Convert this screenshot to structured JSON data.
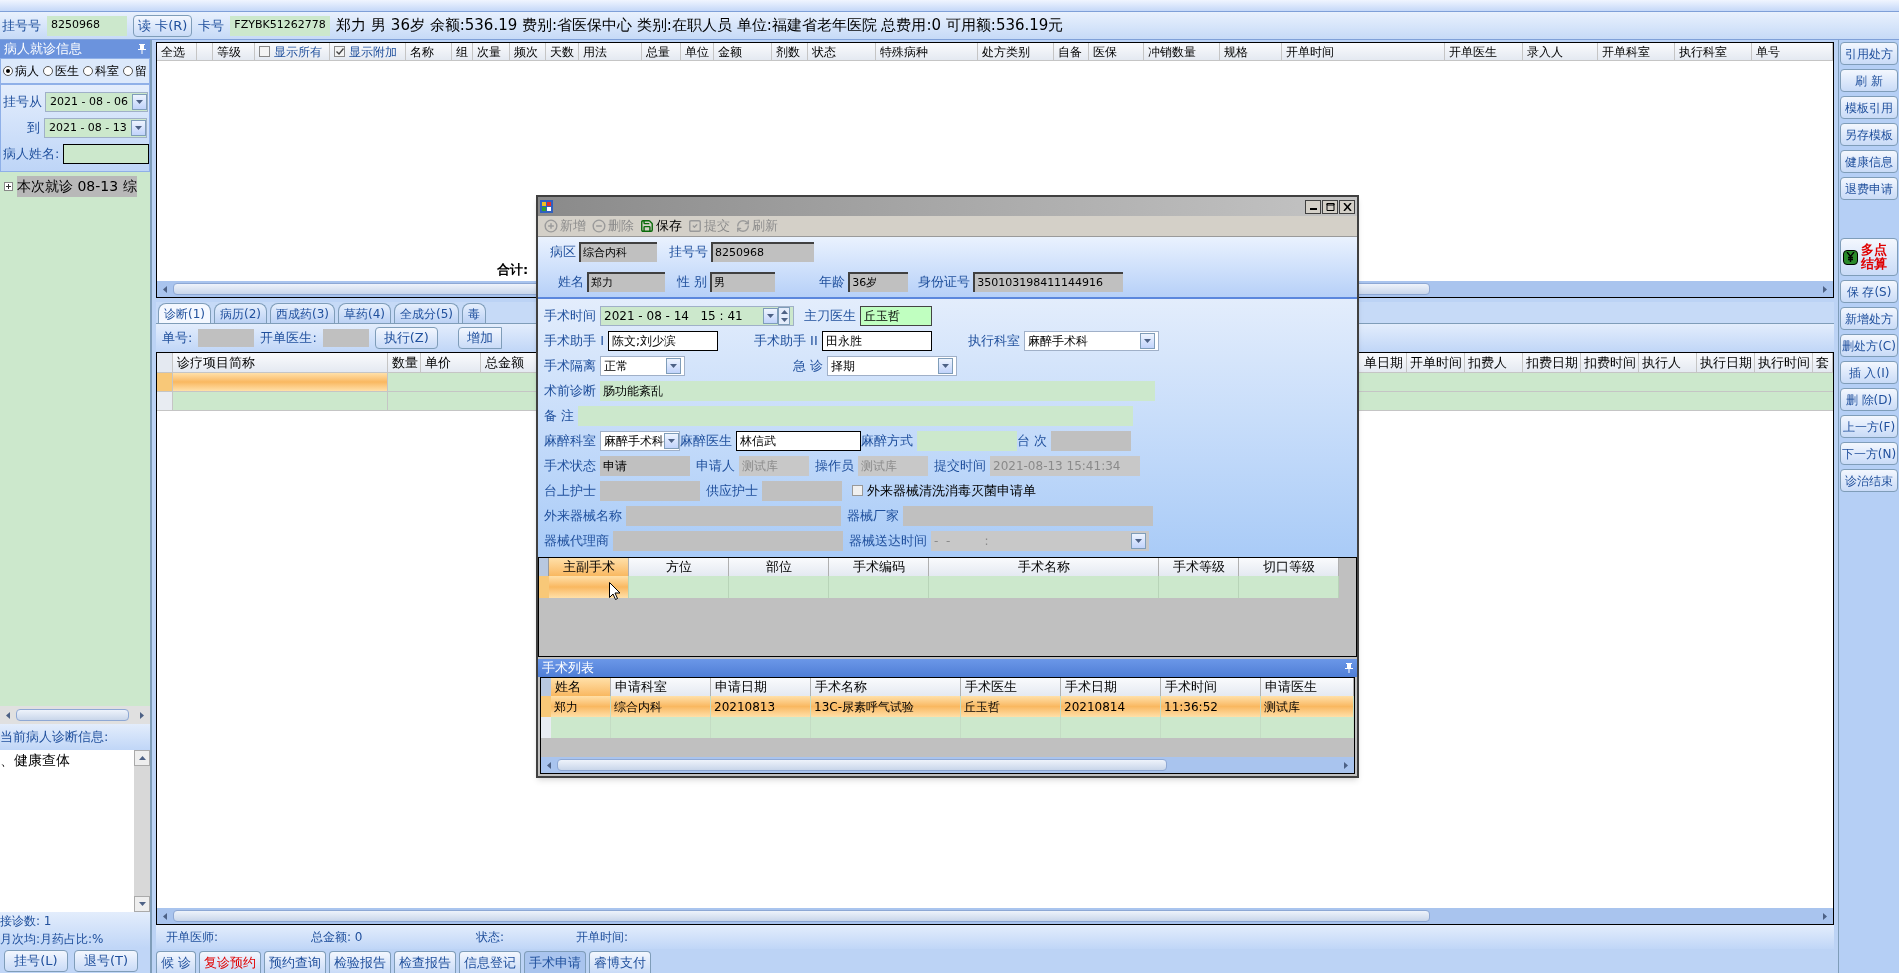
{
  "patient_bar": {
    "reg_label": "挂号号",
    "reg_no": "8250968",
    "read_card_button": "读 卡(R)",
    "card_label": "卡号",
    "card_no": "FZYBK51262778",
    "summary": "郑力 男 36岁 余额:536.19 费别:省医保中心 类别:在职人员 单位:福建省老年医院 总费用:0 可用额:536.19元"
  },
  "left_panel": {
    "title": "病人就诊信息",
    "filters": [
      {
        "label": "病人",
        "selected": true
      },
      {
        "label": "医生",
        "selected": false
      },
      {
        "label": "科室",
        "selected": false
      },
      {
        "label": "留",
        "selected": false
      }
    ],
    "date_from_label": "挂号从",
    "date_from": "2021 - 08 - 06",
    "date_to_label": "到",
    "date_to": "2021 - 08 - 13",
    "name_label": "病人姓名:",
    "tree": [
      {
        "label": "本次就诊 08-13 综",
        "expanded": false,
        "selected": true
      }
    ],
    "diagnosis_title": "当前病人诊断信息:",
    "diagnosis": "、健康查体",
    "stats": [
      "接诊数: 1",
      "月次均:月药占比:%"
    ],
    "buttons": [
      "挂号(L)",
      "退号(T)"
    ]
  },
  "prescription_table": {
    "columns": [
      {
        "kind": "text",
        "label": "全选"
      },
      {
        "kind": "blank"
      },
      {
        "kind": "text",
        "label": "等级"
      },
      {
        "kind": "checkbox",
        "label": "显示所有",
        "checked": false
      },
      {
        "kind": "checkbox",
        "label": "显示附加",
        "checked": true
      },
      {
        "kind": "text",
        "label": "名称"
      },
      {
        "kind": "text",
        "label": "组"
      },
      {
        "kind": "text",
        "label": "次量"
      },
      {
        "kind": "text",
        "label": "频次"
      },
      {
        "kind": "text",
        "label": "天数"
      },
      {
        "kind": "text",
        "label": "用法"
      },
      {
        "kind": "text",
        "label": "总量"
      },
      {
        "kind": "text",
        "label": "单位"
      },
      {
        "kind": "text",
        "label": "金额"
      },
      {
        "kind": "text",
        "label": "剂数"
      },
      {
        "kind": "text",
        "label": "状态"
      },
      {
        "kind": "text",
        "label": "特殊病种"
      },
      {
        "kind": "text",
        "label": "处方类别"
      },
      {
        "kind": "text",
        "label": "自备"
      },
      {
        "kind": "text",
        "label": "医保"
      },
      {
        "kind": "text",
        "label": "冲销数量"
      },
      {
        "kind": "text",
        "label": "规格"
      },
      {
        "kind": "text",
        "label": "开单时间"
      },
      {
        "kind": "text",
        "label": "开单医生"
      },
      {
        "kind": "text",
        "label": "录入人"
      },
      {
        "kind": "text",
        "label": "开单科室"
      },
      {
        "kind": "text",
        "label": "执行科室"
      },
      {
        "kind": "text",
        "label": "单号"
      }
    ],
    "total_label": "合计:"
  },
  "tabs": [
    {
      "label": "诊断(1)",
      "selected": true
    },
    {
      "label": "病历(2)",
      "selected": false
    },
    {
      "label": "西成药(3)",
      "selected": false
    },
    {
      "label": "草药(4)",
      "selected": false
    },
    {
      "label": "全成分(5)",
      "selected": false
    },
    {
      "label": "毒",
      "selected": false
    }
  ],
  "order_toolbar": {
    "order_no_label": "单号:",
    "doctor_label": "开单医生:",
    "execute_button": "执行(Z)",
    "add_button": "增加"
  },
  "items_table": {
    "left_columns": [
      "诊疗项目简称",
      "数量",
      "单价",
      "总金额"
    ],
    "right_columns": [
      "单日期",
      "开单时间",
      "扣费人",
      "扣费日期",
      "扣费时间",
      "执行人",
      "执行日期",
      "执行时间",
      "套"
    ],
    "rows": [
      {
        "selected": true
      },
      {
        "selected": false
      }
    ]
  },
  "status_bar": [
    "开单医师:",
    "总金额: 0",
    "状态:",
    "开单时间:"
  ],
  "bottom_buttons": [
    {
      "label": "候 诊",
      "alert": false,
      "selected": false
    },
    {
      "label": "复诊预约",
      "alert": true,
      "selected": false
    },
    {
      "label": "预约查询",
      "alert": false,
      "selected": false
    },
    {
      "label": "检验报告",
      "alert": false,
      "selected": false
    },
    {
      "label": "检查报告",
      "alert": false,
      "selected": false
    },
    {
      "label": "信息登记",
      "alert": false,
      "selected": false
    },
    {
      "label": "手术申请",
      "alert": false,
      "selected": true
    },
    {
      "label": "睿博支付",
      "alert": false,
      "selected": false
    }
  ],
  "right_buttons": [
    {
      "label": "引用处方",
      "kind": "normal"
    },
    {
      "label": "刷 新",
      "kind": "normal"
    },
    {
      "label": "模板引用",
      "kind": "normal"
    },
    {
      "label": "另存模板",
      "kind": "normal"
    },
    {
      "label": "健康信息",
      "kind": "normal"
    },
    {
      "label": "退费申请",
      "kind": "normal"
    },
    {
      "label": "多点结算",
      "kind": "settle"
    },
    {
      "label": "保 存(S)",
      "kind": "normal"
    },
    {
      "label": "新增处方",
      "kind": "normal"
    },
    {
      "label": "删处方(C)",
      "kind": "normal"
    },
    {
      "label": "插 入(I)",
      "kind": "normal"
    },
    {
      "label": "删 除(D)",
      "kind": "normal"
    },
    {
      "label": "上一方(F)",
      "kind": "normal"
    },
    {
      "label": "下一方(N)",
      "kind": "normal"
    },
    {
      "label": "诊治结束",
      "kind": "normal"
    }
  ],
  "dialog": {
    "toolbar": [
      {
        "label": "新增",
        "disabled": true
      },
      {
        "label": "删除",
        "disabled": true
      },
      {
        "label": "保存",
        "disabled": false
      },
      {
        "label": "提交",
        "disabled": true
      },
      {
        "label": "刷新",
        "disabled": true
      }
    ],
    "header_fields": [
      {
        "label": "病区",
        "value": "综合内科"
      },
      {
        "label": "挂号号",
        "value": "8250968"
      },
      {
        "label": "姓名",
        "value": "郑力"
      },
      {
        "label": "性 别",
        "value": "男"
      },
      {
        "label": "年龄",
        "value": "36岁"
      },
      {
        "label": "身份证号",
        "value": "350103198411144916"
      }
    ],
    "form_rows": [
      [
        {
          "label": "手术时间",
          "kind": "datetime",
          "value": "2021 - 08 - 14   15 : 41"
        },
        {
          "label": "主刀医生",
          "kind": "highlight",
          "value": "丘玉哲"
        }
      ],
      [
        {
          "label": "手术助手 I",
          "kind": "input",
          "value": "陈文;刘少滨"
        },
        {
          "label": "手术助手 II",
          "kind": "input",
          "value": "田永胜"
        },
        {
          "label": "执行科室",
          "kind": "select",
          "value": "麻醉手术科"
        }
      ],
      [
        {
          "label": "手术隔离",
          "kind": "select",
          "value": "正常"
        },
        {
          "label": "急 诊",
          "kind": "select",
          "value": "择期"
        }
      ],
      [
        {
          "label": "术前诊断",
          "kind": "green",
          "value": "肠功能紊乱"
        }
      ],
      [
        {
          "label": "备 注",
          "kind": "green"
        }
      ],
      [
        {
          "label": "麻醉科室",
          "kind": "select",
          "value": "麻醉手术科"
        },
        {
          "label": "麻醉医生",
          "kind": "input",
          "value": "林信武"
        },
        {
          "label": "麻醉方式",
          "kind": "green"
        },
        {
          "label": "台 次",
          "kind": "readonly"
        }
      ],
      [
        {
          "label": "手术状态",
          "kind": "readonly",
          "value": "申请"
        },
        {
          "label": "申请人",
          "kind": "muted",
          "value": "测试库"
        },
        {
          "label": "操作员",
          "kind": "muted",
          "value": "测试库"
        },
        {
          "label": "提交时间",
          "kind": "muted",
          "value": "2021-08-13 15:41:34"
        }
      ],
      [
        {
          "label": "台上护士",
          "kind": "readonly"
        },
        {
          "label": "供应护士",
          "kind": "readonly"
        },
        {
          "label": "外来器械清洗消毒灭菌申请单",
          "kind": "checkbox",
          "checked": false
        }
      ],
      [
        {
          "label": "外来器械名称",
          "kind": "readonly"
        },
        {
          "label": "器械厂家",
          "kind": "readonly"
        }
      ],
      [
        {
          "label": "器械代理商",
          "kind": "readonly"
        },
        {
          "label": "器械送达时间",
          "kind": "muted-select",
          "value": "-  -         :"
        }
      ]
    ],
    "surgery_grid": {
      "columns": [
        {
          "label": "主副手术",
          "selected": true
        },
        {
          "label": "方位",
          "selected": false
        },
        {
          "label": "部位",
          "selected": false
        },
        {
          "label": "手术编码",
          "selected": false
        },
        {
          "label": "手术名称",
          "selected": false
        },
        {
          "label": "手术等级",
          "selected": false
        },
        {
          "label": "切口等级",
          "selected": false
        }
      ],
      "rows": [
        {
          "selected": true
        }
      ]
    },
    "list_title": "手术列表",
    "list": {
      "columns": [
        "姓名",
        "申请科室",
        "申请日期",
        "手术名称",
        "手术医生",
        "手术日期",
        "手术时间",
        "申请医生"
      ],
      "rows": [
        {
          "selected": true,
          "cells": [
            "郑力",
            "综合内科",
            "20210813",
            "13C-尿素呼气试验",
            "丘玉哲",
            "20210814",
            "11:36:52",
            "测试库"
          ]
        },
        {
          "selected": false
        }
      ]
    }
  }
}
